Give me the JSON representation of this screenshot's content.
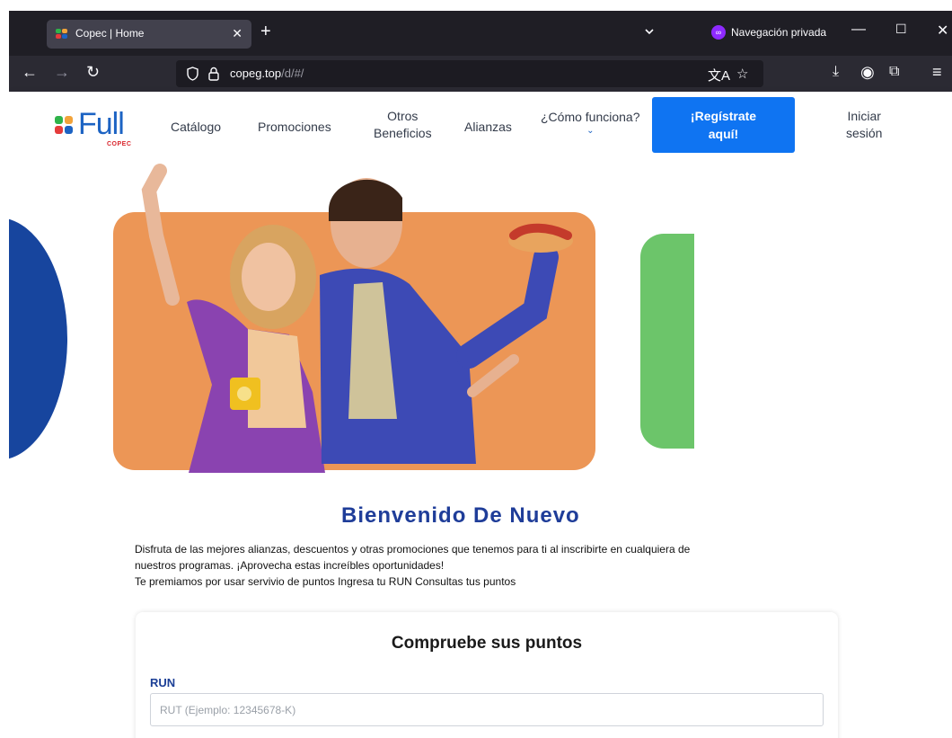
{
  "browser": {
    "tab": {
      "title": "Copec | Home",
      "close": "✕"
    },
    "new_tab": "+",
    "private_label": "Navegación privada",
    "window_controls": {
      "minimize": "—",
      "maximize": "☐",
      "close": "✕"
    },
    "url": {
      "host": "copeg.top",
      "path": "/d/#/"
    },
    "icons": [
      "back-icon",
      "forward-icon",
      "reload-icon",
      "shield-icon",
      "lock-icon",
      "translate-icon",
      "star-icon",
      "download-icon",
      "account-icon",
      "extensions-icon",
      "menu-icon"
    ]
  },
  "site": {
    "logo": {
      "word": "Full",
      "sub": "COPEC"
    },
    "nav": {
      "catalogo": "Catálogo",
      "promociones": "Promociones",
      "otros_line1": "Otros",
      "otros_line2": "Beneficios",
      "alianzas": "Alianzas",
      "como_funciona": "¿Cómo funciona?",
      "chevron": "⌄"
    },
    "register": {
      "line1": "¡Regístrate",
      "line2": "aquí!"
    },
    "login": {
      "line1": "Iniciar",
      "line2": "sesión"
    },
    "colors": {
      "brand_blue": "#1c63c3",
      "cta": "#0f74f2",
      "hero_orange": "#ec9656",
      "hero_green": "#6cc56a",
      "dark_blue": "#17459e"
    }
  },
  "content": {
    "welcome": "Bienvenido De Nuevo",
    "intro_1": "Disfruta de las mejores alianzas, descuentos y otras promociones que tenemos para ti al inscribirte en cualquiera de",
    "intro_2": "nuestros programas. ¡Aprovecha estas increíbles oportunidades!",
    "intro_3": "Te premiamos por usar servivio de puntos Ingresa tu RUN Consultas tus puntos",
    "points_title": "Compruebe sus puntos",
    "run_label": "RUN",
    "run_placeholder": "RUT (Ejemplo: 12345678-K)",
    "run_value": ""
  }
}
